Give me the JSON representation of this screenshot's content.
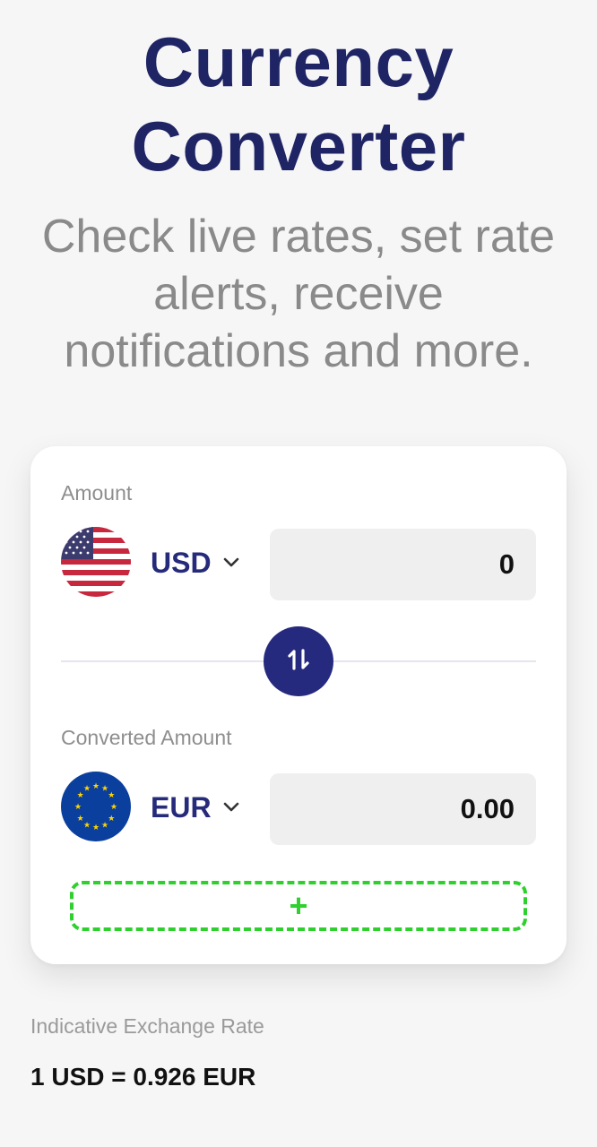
{
  "header": {
    "title_line1": "Currency",
    "title_line2": "Converter",
    "subtitle": "Check live rates, set rate alerts, receive notifications and more."
  },
  "converter": {
    "amount_label": "Amount",
    "from": {
      "code": "USD",
      "flag_icon": "us-flag-icon",
      "value": "0"
    },
    "converted_label": "Converted Amount",
    "to": {
      "code": "EUR",
      "flag_icon": "eu-flag-icon",
      "value": "0.00"
    },
    "swap_icon": "swap-vertical-icon",
    "add_label": "+"
  },
  "footer": {
    "rate_label": "Indicative Exchange Rate",
    "rate_value": "1 USD = 0.926 EUR"
  },
  "colors": {
    "title": "#1f2465",
    "accent": "#262a7e",
    "add_border": "#2ed02e",
    "background": "#f6f6f6"
  }
}
